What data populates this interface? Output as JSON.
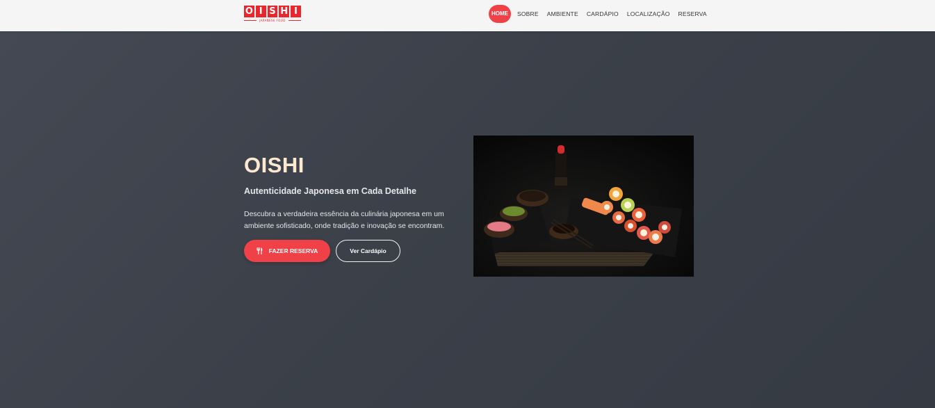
{
  "brand": {
    "logo_letters": [
      "O",
      "I",
      "S",
      "H",
      "I"
    ],
    "logo_tagline": "JAPANESE FOOD",
    "accent_color": "#f04148"
  },
  "nav": {
    "items": [
      {
        "label": "HOME",
        "active": true
      },
      {
        "label": "SOBRE",
        "active": false
      },
      {
        "label": "AMBIENTE",
        "active": false
      },
      {
        "label": "CARDÁPIO",
        "active": false
      },
      {
        "label": "LOCALIZAÇÃO",
        "active": false
      },
      {
        "label": "RESERVA",
        "active": false
      }
    ]
  },
  "hero": {
    "title": "OISHI",
    "subtitle": "Autenticidade Japonesa em Cada Detalhe",
    "description": "Descubra a verdadeira essência da culinária japonesa em um ambiente sofisticado, onde tradição e inovação se encontram.",
    "primary_button": {
      "label": "FAZER RESERVA",
      "icon": "utensils-icon"
    },
    "secondary_button": {
      "label": "Ver Cardápio"
    },
    "image_subject": "sushi-platter-photo"
  }
}
